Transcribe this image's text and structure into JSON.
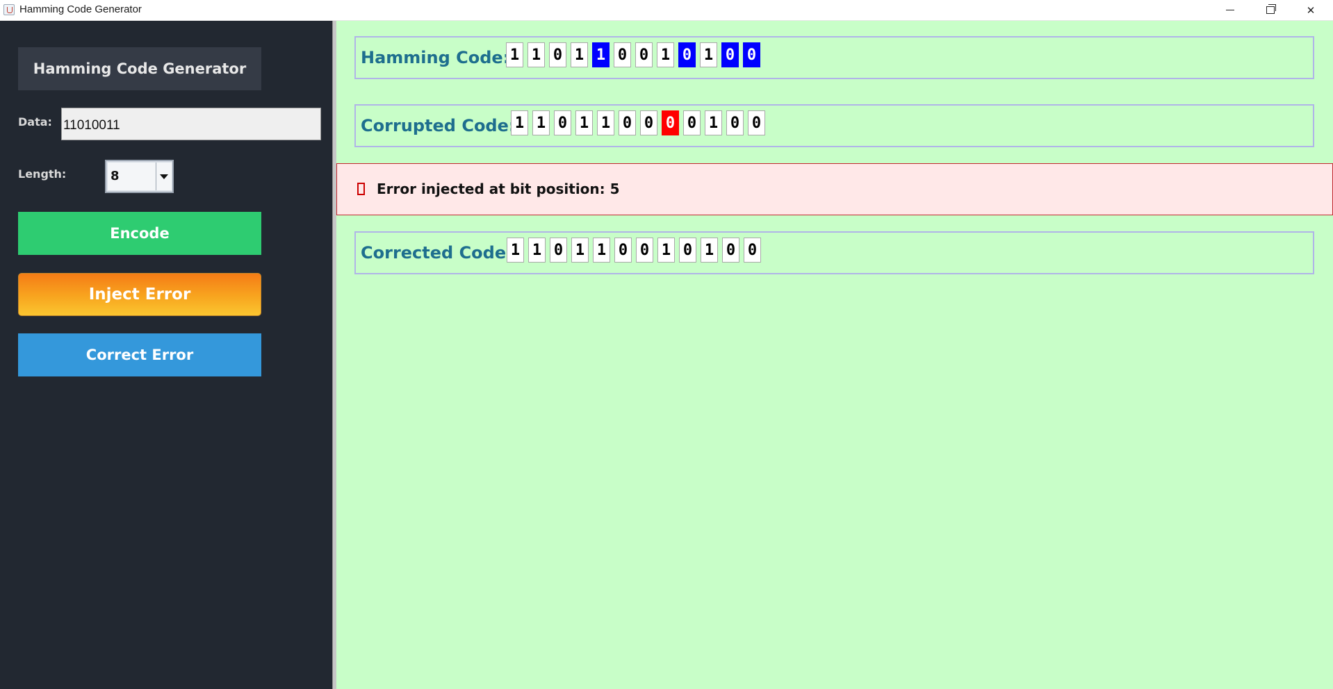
{
  "window": {
    "title": "Hamming Code Generator"
  },
  "sidebar": {
    "title": "Hamming Code Generator",
    "data_label": "Data:",
    "data_value": "11010011",
    "length_label": "Length:",
    "length_value": "8",
    "buttons": {
      "encode": "Encode",
      "inject": "Inject Error",
      "correct": "Correct Error"
    }
  },
  "main": {
    "hamming": {
      "label": "Hamming Code:",
      "bits": [
        "1",
        "1",
        "0",
        "1",
        "1",
        "0",
        "0",
        "1",
        "0",
        "1",
        "0",
        "0"
      ],
      "parity_positions_highlighted": [
        5,
        9,
        11,
        12
      ]
    },
    "corrupted": {
      "label": "Corrupted Code:",
      "bits": [
        "1",
        "1",
        "0",
        "1",
        "1",
        "0",
        "0",
        "0",
        "0",
        "1",
        "0",
        "0"
      ],
      "error_highlighted": 8
    },
    "error_message": "Error injected at bit position: 5",
    "corrected": {
      "label": "Corrected Code:",
      "bits": [
        "1",
        "1",
        "0",
        "1",
        "1",
        "0",
        "0",
        "1",
        "0",
        "1",
        "0",
        "0"
      ]
    }
  },
  "colors": {
    "sidebar_bg": "#222831",
    "main_bg": "#c8fec8",
    "parity_bit": "#0000ff",
    "error_bit": "#ff0000",
    "encode_button": "#2ecc71",
    "inject_button": "#f8a51f",
    "correct_button": "#3498db",
    "label_text": "#1e6e8e"
  }
}
